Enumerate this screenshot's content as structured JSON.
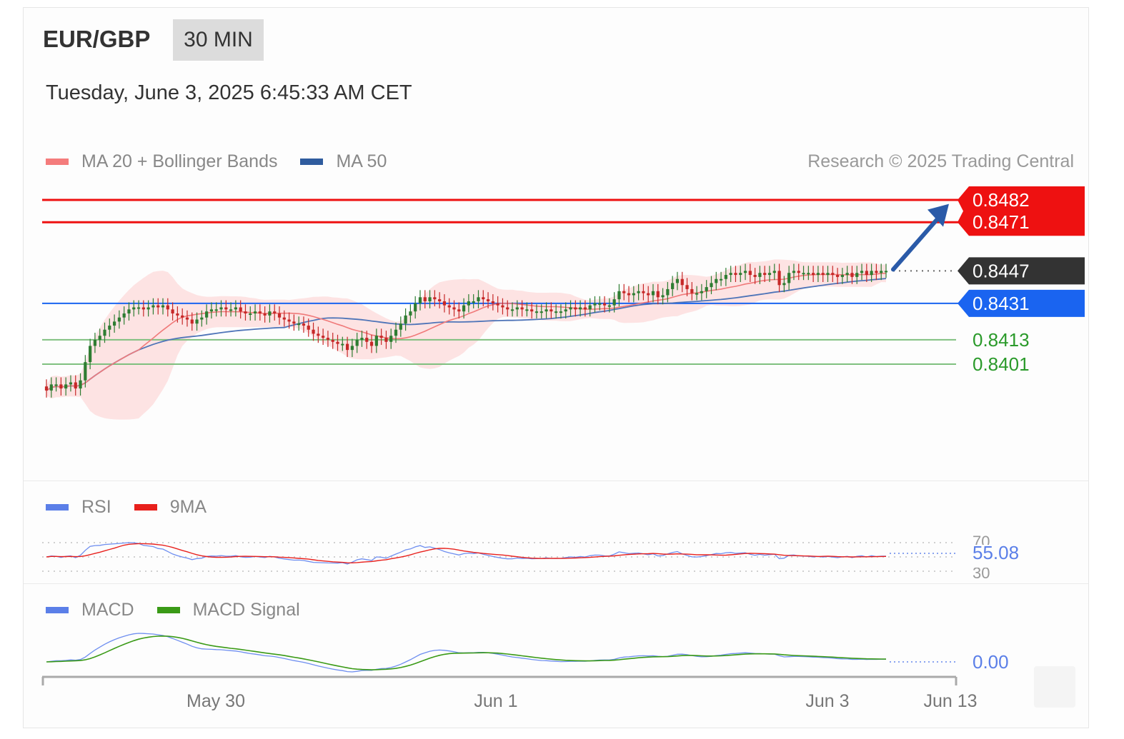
{
  "header": {
    "pair": "EUR/GBP",
    "timeframe": "30 MIN",
    "datetime": "Tuesday, June 3, 2025 6:45:33 AM CET"
  },
  "legend_main": [
    {
      "label": "MA 20 + Bollinger Bands",
      "color": "#f47c7c"
    },
    {
      "label": "MA 50",
      "color": "#2f5c9e"
    }
  ],
  "legend_rsi": [
    {
      "label": "RSI",
      "color": "#5b7fe8"
    },
    {
      "label": "9MA",
      "color": "#e8201c"
    }
  ],
  "legend_macd": [
    {
      "label": "MACD",
      "color": "#5b7fe8"
    },
    {
      "label": "MACD Signal",
      "color": "#3a9a16"
    }
  ],
  "credit": "Research © 2025 Trading Central",
  "colors": {
    "resistance": "#ee1111",
    "pivot": "#1a64f0",
    "support": "#2a9a2a",
    "current": "#333333",
    "candle_up": "#2e7d32",
    "candle_down": "#c62828",
    "band_fill": "#fde3e3",
    "arrow": "#2a5aa8"
  },
  "chart_data": [
    {
      "type": "candlestick",
      "panel": "price",
      "x_tick_labels": [
        "May 30",
        "Jun 1",
        "Jun 3",
        "Jun 13"
      ],
      "ylim": [
        0.836,
        0.849
      ],
      "levels": [
        {
          "value": 0.8482,
          "label": "0.8482",
          "kind": "resistance"
        },
        {
          "value": 0.8471,
          "label": "0.8471",
          "kind": "resistance"
        },
        {
          "value": 0.8447,
          "label": "0.8447",
          "kind": "current"
        },
        {
          "value": 0.8431,
          "label": "0.8431",
          "kind": "pivot"
        },
        {
          "value": 0.8413,
          "label": "0.8413",
          "kind": "support"
        },
        {
          "value": 0.8401,
          "label": "0.8401",
          "kind": "support"
        }
      ],
      "close": [
        0.8388,
        0.8391,
        0.8391,
        0.8389,
        0.8391,
        0.8392,
        0.8389,
        0.8393,
        0.8402,
        0.841,
        0.8413,
        0.8415,
        0.8418,
        0.842,
        0.8422,
        0.8424,
        0.8426,
        0.8428,
        0.8429,
        0.8429,
        0.8428,
        0.8429,
        0.843,
        0.8429,
        0.843,
        0.8428,
        0.8426,
        0.8425,
        0.8424,
        0.8423,
        0.8421,
        0.8423,
        0.8424,
        0.8427,
        0.8428,
        0.8428,
        0.8429,
        0.8428,
        0.8428,
        0.8429,
        0.8427,
        0.8426,
        0.8426,
        0.8427,
        0.8426,
        0.8425,
        0.8427,
        0.8426,
        0.8424,
        0.8423,
        0.8422,
        0.8421,
        0.8421,
        0.842,
        0.8418,
        0.8416,
        0.8415,
        0.8414,
        0.8413,
        0.8412,
        0.8411,
        0.8411,
        0.8408,
        0.841,
        0.8413,
        0.8414,
        0.8412,
        0.841,
        0.8415,
        0.8414,
        0.8412,
        0.8415,
        0.8418,
        0.8421,
        0.8425,
        0.8427,
        0.8431,
        0.8434,
        0.8432,
        0.8434,
        0.8433,
        0.8432,
        0.843,
        0.8429,
        0.8428,
        0.8427,
        0.843,
        0.8432,
        0.8432,
        0.8434,
        0.8433,
        0.8432,
        0.8431,
        0.843,
        0.8429,
        0.8428,
        0.8428,
        0.8429,
        0.8428,
        0.8428,
        0.8427,
        0.8427,
        0.8427,
        0.8428,
        0.8427,
        0.8427,
        0.8427,
        0.8428,
        0.8429,
        0.8428,
        0.8429,
        0.8428,
        0.843,
        0.8431,
        0.8431,
        0.843,
        0.843,
        0.8433,
        0.8437,
        0.8436,
        0.8435,
        0.8436,
        0.8437,
        0.8436,
        0.8435,
        0.8437,
        0.8434,
        0.8435,
        0.8438,
        0.8441,
        0.8443,
        0.844,
        0.8438,
        0.8436,
        0.8436,
        0.8437,
        0.8439,
        0.8441,
        0.8443,
        0.8443,
        0.8445,
        0.8446,
        0.8445,
        0.8446,
        0.8447,
        0.8445,
        0.8444,
        0.8446,
        0.8445,
        0.8446,
        0.8447,
        0.844,
        0.8441,
        0.8446,
        0.8447,
        0.8446,
        0.8446,
        0.8446,
        0.8445,
        0.8446,
        0.8445,
        0.8446,
        0.8445,
        0.8444,
        0.8445,
        0.8446,
        0.8444,
        0.8446,
        0.8447,
        0.8445,
        0.8447,
        0.8446,
        0.8447,
        0.8447
      ]
    },
    {
      "type": "line",
      "panel": "rsi",
      "series": [
        {
          "name": "RSI"
        },
        {
          "name": "9MA"
        }
      ],
      "guides": [
        70,
        50,
        30
      ],
      "guide_labels": [
        "70",
        "30"
      ],
      "last_value": "55.08"
    },
    {
      "type": "line",
      "panel": "macd",
      "series": [
        {
          "name": "MACD"
        },
        {
          "name": "MACD Signal"
        }
      ],
      "last_value": "0.00"
    }
  ]
}
